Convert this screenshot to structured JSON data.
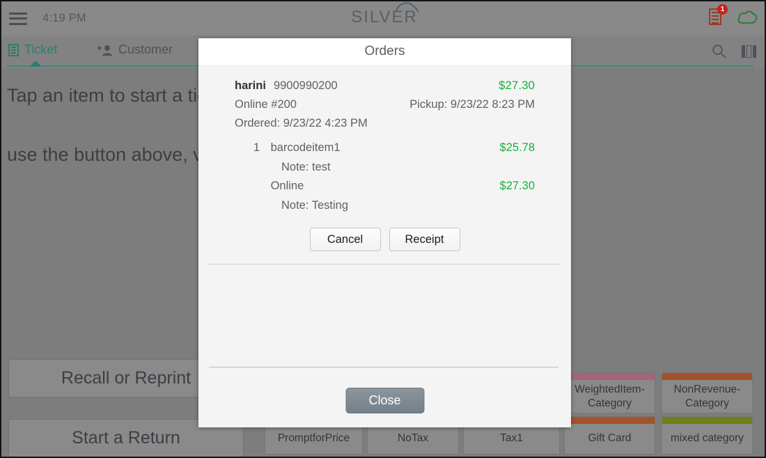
{
  "topbar": {
    "menu_icon": "hamburger-icon",
    "time": "4:19 PM",
    "logo_text": "SILVER",
    "receipt_icon": "receipt-icon",
    "receipt_badge": "1",
    "cloud_icon": "cloud-icon"
  },
  "tabs": {
    "ticket_label": "Ticket",
    "customer_label": "Customer",
    "search_icon": "search-icon",
    "panel_icon": "panel-layout-icon"
  },
  "main": {
    "line1": "Tap an item to start a ticket, or use a Favorites. It is easy to",
    "line2": "use the button above, view Favorites.",
    "recall_label": "Recall or Reprint",
    "return_label": "Start a Return"
  },
  "categories": [
    {
      "label": "WeightedItem-Category",
      "color": "#a4647a"
    },
    {
      "label": "NonRevenue-Category",
      "color": "#a4522a"
    },
    {
      "label": "PromptforPrice",
      "color": "#8a8a8a"
    },
    {
      "label": "NoTax",
      "color": "#8a8a8a"
    },
    {
      "label": "Tax1",
      "color": "#8a8a8a"
    },
    {
      "label": "Gift Card",
      "color": "#a4522a"
    },
    {
      "label": "mixed category",
      "color": "#6e7f1e"
    }
  ],
  "modal": {
    "title": "Orders",
    "order": {
      "customer_name": "harini",
      "phone": "9900990200",
      "total": "$27.30",
      "channel": "Online #200",
      "pickup": "Pickup: 9/23/22 8:23 PM",
      "ordered": "Ordered: 9/23/22 4:23 PM",
      "lines": [
        {
          "qty": "1",
          "name": "barcodeitem1",
          "price": "$25.78",
          "note": "Note: test"
        },
        {
          "qty": "",
          "name": "Online",
          "price": "$27.30",
          "note": "Note: Testing"
        }
      ]
    },
    "cancel_label": "Cancel",
    "receipt_label": "Receipt",
    "close_label": "Close"
  },
  "colors": {
    "accent_teal": "#2d7d6e",
    "money_green": "#18b038",
    "badge_red": "#cc1f1f",
    "receipt_brown": "#9a3b27",
    "cloud_green": "#1f7a34"
  }
}
